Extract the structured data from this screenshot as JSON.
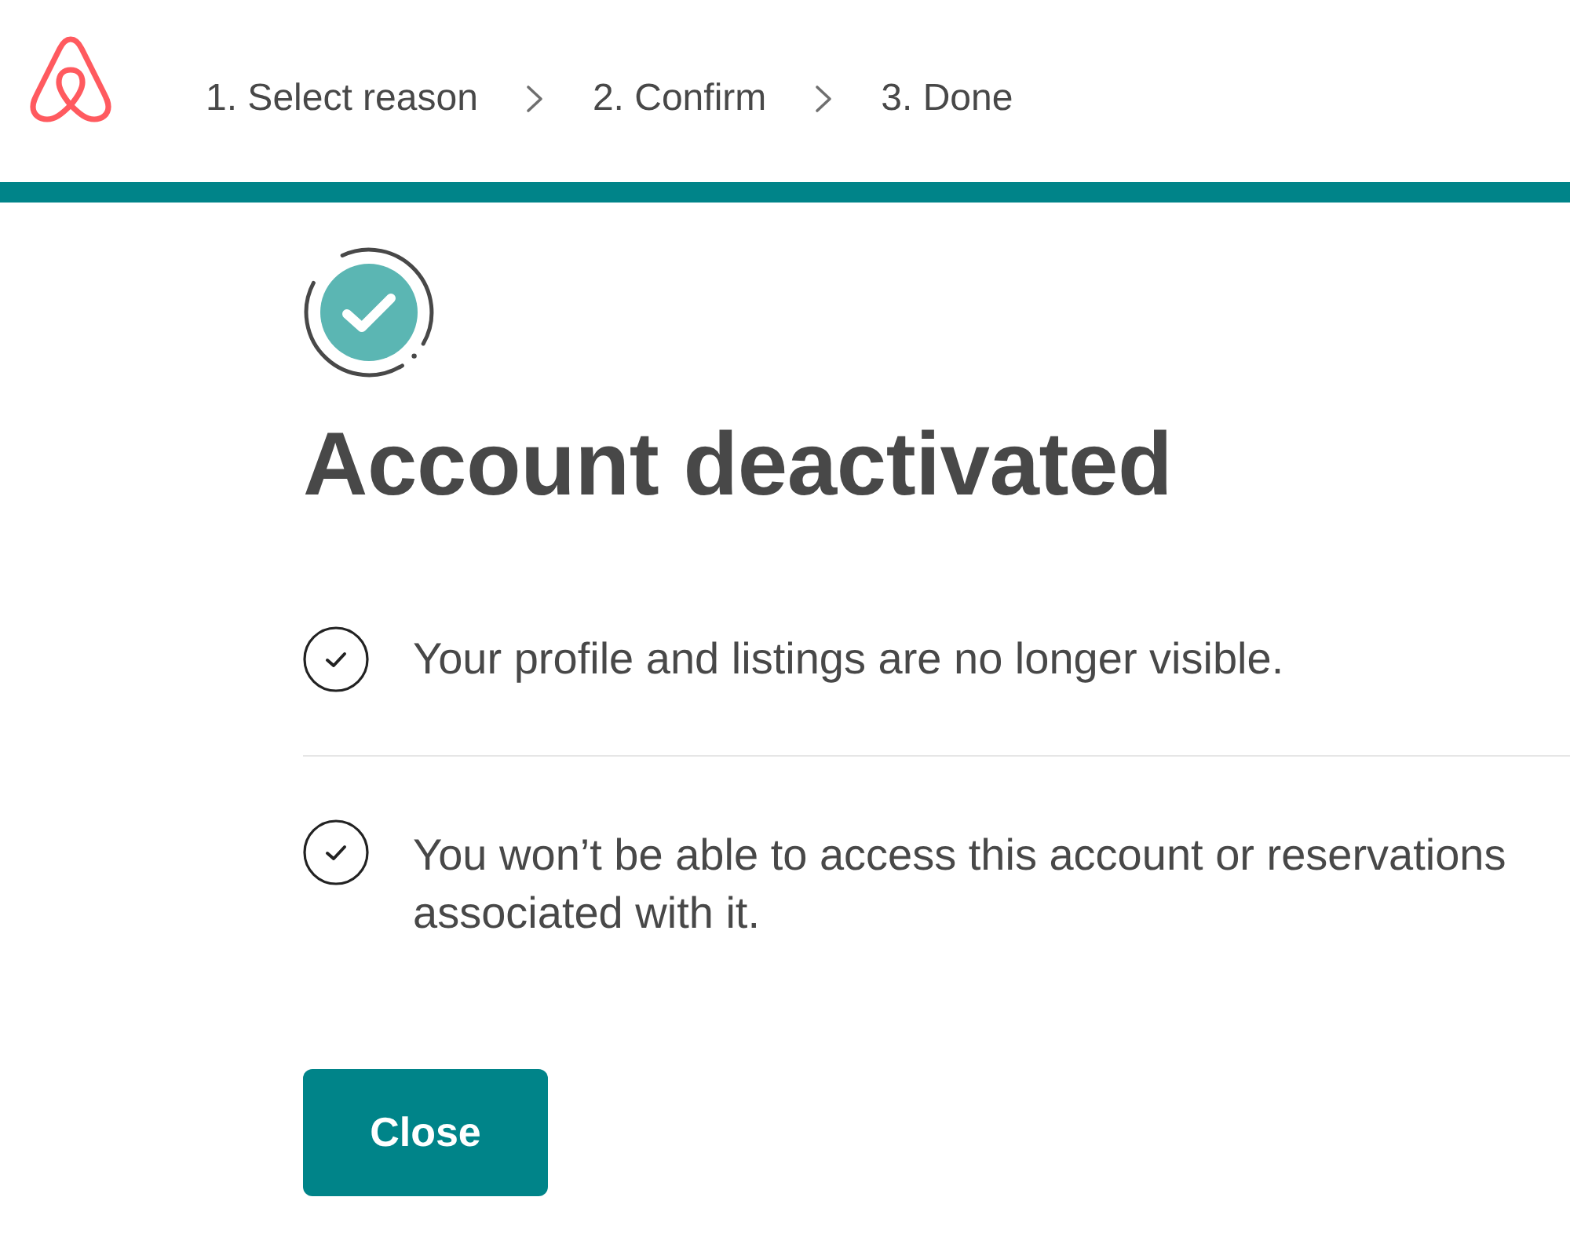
{
  "header": {
    "steps": [
      {
        "label": "1. Select reason"
      },
      {
        "label": "2. Confirm"
      },
      {
        "label": "3. Done"
      }
    ]
  },
  "progress": {
    "level": 1
  },
  "title": "Account deactivated",
  "checklist": [
    {
      "text": "Your profile and listings are no longer visible."
    },
    {
      "text": "You won’t be able to access this account or reservations associated with it."
    }
  ],
  "buttons": [
    {
      "label": "Close"
    }
  ]
}
